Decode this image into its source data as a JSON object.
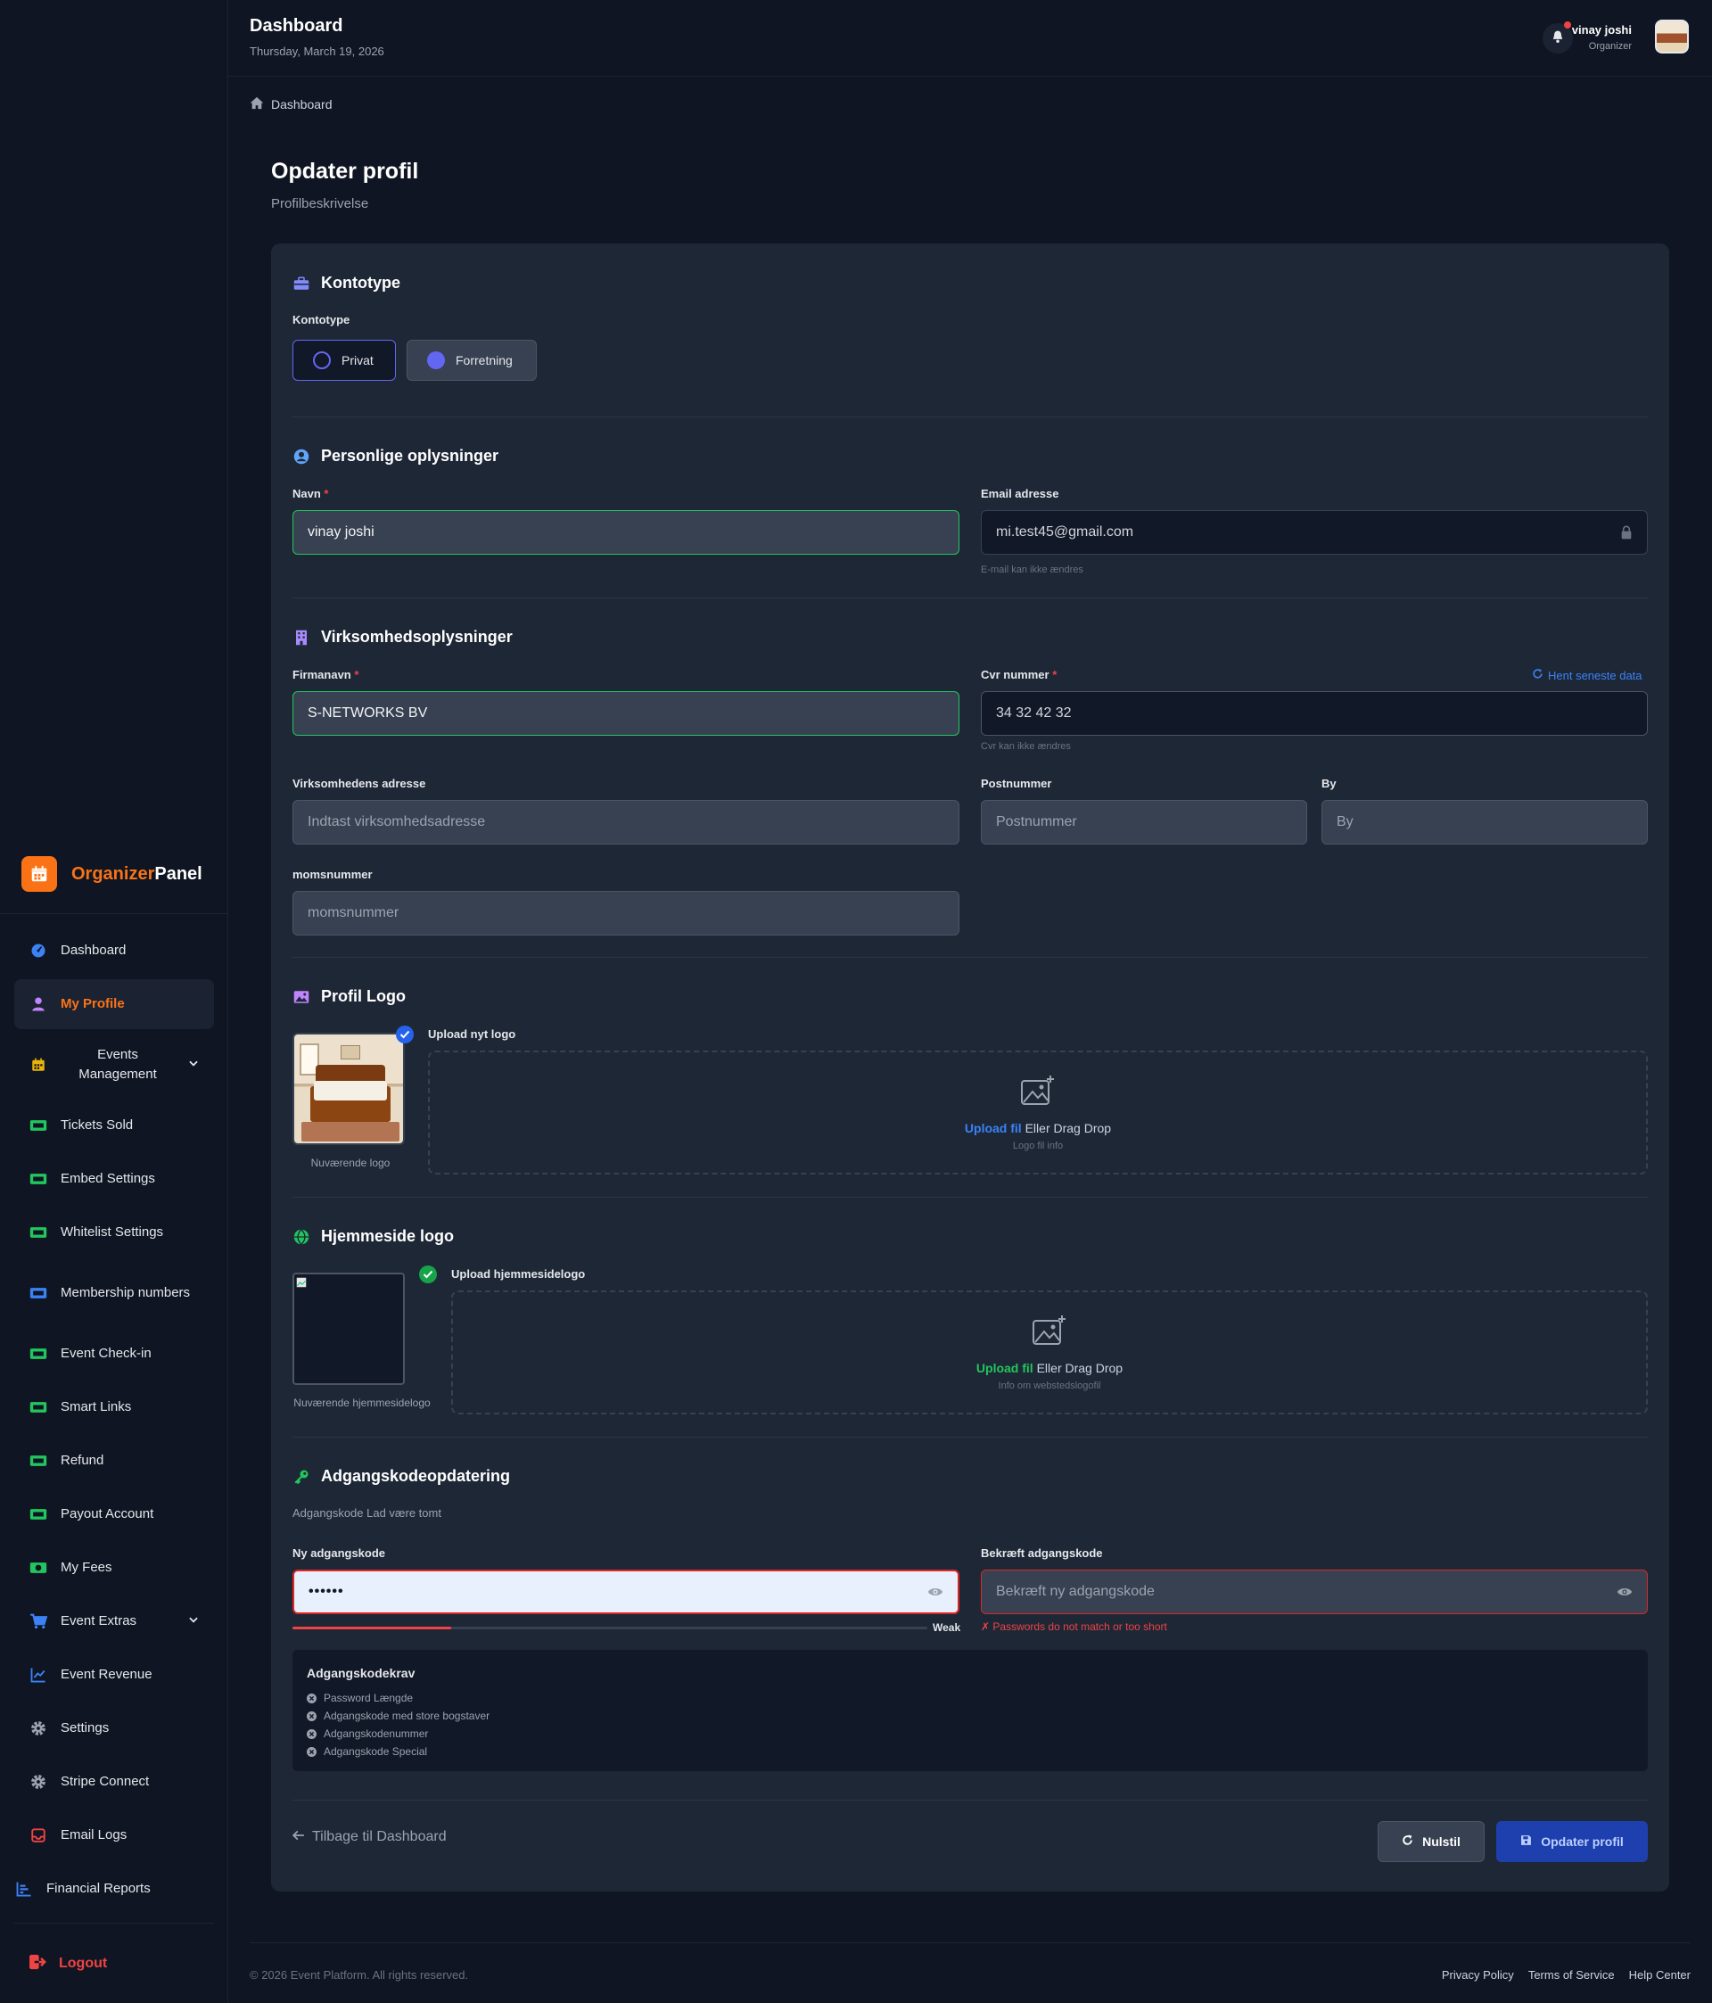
{
  "brand": {
    "part1": "Organizer",
    "part2": "Panel"
  },
  "sidebar": {
    "items": [
      {
        "label": "Dashboard",
        "icon": "gauge-icon",
        "color": "#3b82f6"
      },
      {
        "label": "My Profile",
        "icon": "user-icon",
        "color": "#f97316",
        "active": true
      },
      {
        "label": "Events Management",
        "icon": "calendar-icon",
        "color": "#eab308",
        "expandable": true
      },
      {
        "label": "Tickets Sold",
        "icon": "ticket-icon",
        "color": "#22c55e"
      },
      {
        "label": "Embed Settings",
        "icon": "ticket-icon",
        "color": "#22c55e"
      },
      {
        "label": "Whitelist Settings",
        "icon": "ticket-icon",
        "color": "#22c55e"
      },
      {
        "label": "Membership numbers",
        "icon": "id-card-icon",
        "color": "#3b82f6"
      },
      {
        "label": "Event Check-in",
        "icon": "ticket-icon",
        "color": "#22c55e"
      },
      {
        "label": "Smart Links",
        "icon": "ticket-icon",
        "color": "#22c55e"
      },
      {
        "label": "Refund",
        "icon": "ticket-icon",
        "color": "#22c55e"
      },
      {
        "label": "Payout Account",
        "icon": "ticket-icon",
        "color": "#22c55e"
      },
      {
        "label": "My Fees",
        "icon": "money-icon",
        "color": "#22c55e"
      },
      {
        "label": "Event Extras",
        "icon": "cart-icon",
        "color": "#3b82f6",
        "expandable": true
      },
      {
        "label": "Event Revenue",
        "icon": "chart-line-icon",
        "color": "#3b82f6"
      },
      {
        "label": "Settings",
        "icon": "gear-icon",
        "color": "#9ca3af"
      },
      {
        "label": "Stripe Connect",
        "icon": "gear-icon",
        "color": "#9ca3af"
      },
      {
        "label": "Email Logs",
        "icon": "inbox-icon",
        "color": "#ef4444"
      },
      {
        "label": "Financial Reports",
        "icon": "bar-chart-icon",
        "color": "#3b82f6"
      }
    ],
    "logout": "Logout"
  },
  "header": {
    "title": "Dashboard",
    "date": "Thursday, March 19, 2026",
    "user_name": "vinay joshi",
    "user_role": "Organizer"
  },
  "breadcrumb": "Dashboard",
  "page": {
    "title": "Opdater profil",
    "subtitle": "Profilbeskrivelse"
  },
  "account_type": {
    "section_title": "Kontotype",
    "label": "Kontotype",
    "options": [
      "Privat",
      "Forretning"
    ]
  },
  "personal": {
    "section_title": "Personlige oplysninger",
    "name_label": "Navn",
    "name_value": "vinay joshi",
    "email_label": "Email adresse",
    "email_value": "mi.test45@gmail.com",
    "email_hint": "E-mail kan ikke ændres"
  },
  "business": {
    "section_title": "Virksomhedsoplysninger",
    "company_label": "Firmanavn",
    "company_value": "S-NETWORKS BV",
    "cvr_label": "Cvr nummer",
    "cvr_value": "34 32 42 32",
    "cvr_hint": "Cvr kan ikke ændres",
    "fetch_label": "Hent seneste data",
    "address_label": "Virksomhedens adresse",
    "address_placeholder": "Indtast virksomhedsadresse",
    "zip_label": "Postnummer",
    "zip_placeholder": "Postnummer",
    "city_label": "By",
    "city_placeholder": "By",
    "vat_label": "momsnummer",
    "vat_placeholder": "momsnummer"
  },
  "profile_logo": {
    "section_title": "Profil Logo",
    "upload_label": "Upload nyt logo",
    "current_caption": "Nuværende logo",
    "dz_link": "Upload fil",
    "dz_text": " Eller Drag Drop",
    "dz_info": "Logo fil info"
  },
  "website_logo": {
    "section_title": "Hjemmeside logo",
    "upload_label": "Upload hjemmesidelogo",
    "current_caption": "Nuværende hjemmesidelogo",
    "dz_link": "Upload fil",
    "dz_text": " Eller Drag Drop",
    "dz_info": "Info om webstedslogofil"
  },
  "password": {
    "section_title": "Adgangskodeopdatering",
    "hint": "Adgangskode Lad være tomt",
    "new_label": "Ny adgangskode",
    "new_value": "••••••",
    "confirm_label": "Bekræft adgangskode",
    "confirm_placeholder": "Bekræft ny adgangskode",
    "strength_label": "Weak",
    "strength": 0.25,
    "error": "✗ Passwords do not match or too short",
    "requirements_title": "Adgangskodekrav",
    "requirements": [
      "Password Længde",
      "Adgangskode med store bogstaver",
      "Adgangskodenummer",
      "Adgangskode Special"
    ]
  },
  "actions": {
    "back": "Tilbage til Dashboard",
    "reset": "Nulstil",
    "update": "Opdater profil"
  },
  "footer": {
    "copyright": "© 2026 Event Platform. All rights reserved.",
    "links": [
      "Privacy Policy",
      "Terms of Service",
      "Help Center"
    ]
  }
}
